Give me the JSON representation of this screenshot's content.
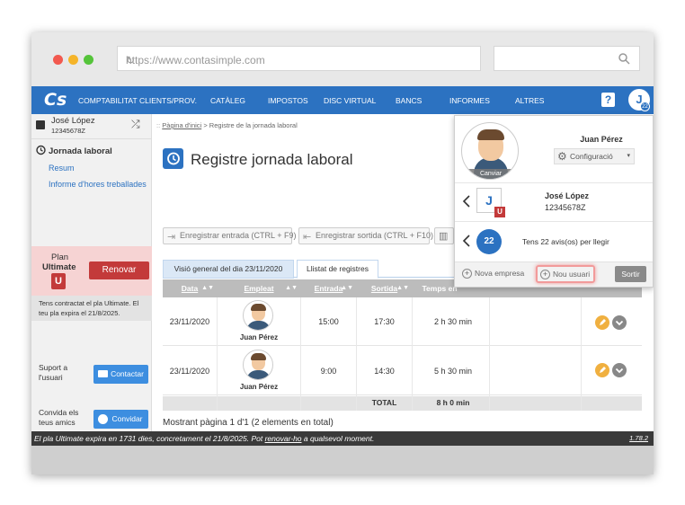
{
  "browser": {
    "url": "https://www.contasimple.com"
  },
  "nav": {
    "logo": "Cs",
    "items": [
      "COMPTABILITAT",
      "CLIENTS/PROV.",
      "CATÀLEG",
      "IMPOSTOS",
      "DISC VIRTUAL",
      "BANCS",
      "INFORMES",
      "ALTRES"
    ],
    "help": "?",
    "avatar": "J",
    "badge": "22"
  },
  "sidebar": {
    "user_name": "José López",
    "user_id": "12345678Z",
    "section": "Jornada laboral",
    "links": [
      "Resum",
      "Informe d'hores treballades"
    ],
    "plan_label": "Plan",
    "plan_name": "Ultimate",
    "plan_icon": "U",
    "renew": "Renovar",
    "plan_info": "Tens contractat el pla Ultimate. El teu pla expira el 21/8/2025.",
    "support_label": "Suport a l'usuari",
    "contact": "Contactar",
    "invite_label": "Convida els teus amics",
    "invite": "Convidar"
  },
  "main": {
    "breadcrumb_home": "Pàgina d'inici",
    "breadcrumb_sep": " > ",
    "breadcrumb_current": "Registre de la jornada laboral",
    "title": "Registre jornada laboral",
    "btn_in": "Enregistrar entrada (CTRL + F9)",
    "btn_out": "Enregistrar sortida (CTRL + F10)",
    "tabs": [
      "Visió general del dia 23/11/2020",
      "Llistat de registres"
    ],
    "columns": [
      "Data",
      "Empleat",
      "Entrada",
      "Sortida",
      "Temps en"
    ],
    "rows": [
      {
        "date": "23/11/2020",
        "employee": "Juan Pérez",
        "in": "15:00",
        "out": "17:30",
        "time": "2 h 30 min"
      },
      {
        "date": "23/11/2020",
        "employee": "Juan Pérez",
        "in": "9:00",
        "out": "14:30",
        "time": "5 h 30 min"
      }
    ],
    "total_label": "TOTAL",
    "total_value": "8 h 0 min",
    "pagination": "Mostrant pàgina 1 d'1 (2 elements en total)"
  },
  "footer": {
    "text_before": "El pla Ultimate expira en 1731 dies, concretament el 21/8/2025. Pot ",
    "link": "renovar-ho",
    "text_after": " a qualsevol moment.",
    "version": "1.78.2"
  },
  "popup": {
    "name": "Juan Pérez",
    "change": "Canviar",
    "config": "Configuració",
    "company_name": "José López",
    "company_id": "12345678Z",
    "company_letter": "J",
    "company_badge": "U",
    "notifications_count": "22",
    "notifications_text": "Tens 22 avis(os) per llegir",
    "new_company": "Nova empresa",
    "new_user": "Nou usuari",
    "logout": "Sortir"
  },
  "colors": {
    "primary": "#2c72c1",
    "danger": "#c33a3a",
    "footer": "#3a3a3a"
  }
}
